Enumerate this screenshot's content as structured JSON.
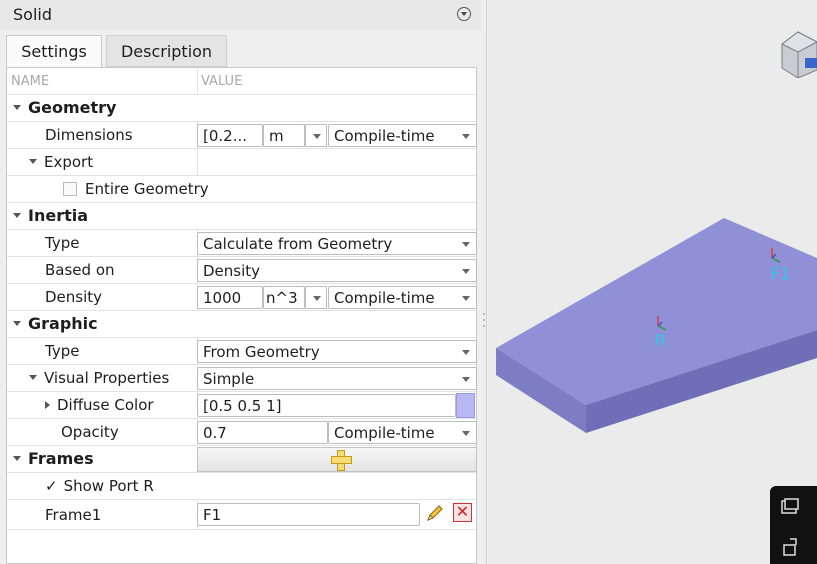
{
  "panel": {
    "title": "Solid",
    "tabs": [
      "Settings",
      "Description"
    ],
    "columns": {
      "name": "NAME",
      "value": "VALUE"
    }
  },
  "geometry": {
    "section": "Geometry",
    "dimensions_label": "Dimensions",
    "dimensions_value": "[0.2...",
    "dimensions_unit": "m",
    "dimensions_mode": "Compile-time",
    "export_label": "Export",
    "entire_geometry_label": "Entire Geometry",
    "entire_geometry_checked": false
  },
  "inertia": {
    "section": "Inertia",
    "type_label": "Type",
    "type_value": "Calculate from Geometry",
    "based_on_label": "Based on",
    "based_on_value": "Density",
    "density_label": "Density",
    "density_value": "1000",
    "density_unit": "n^3",
    "density_mode": "Compile-time"
  },
  "graphic": {
    "section": "Graphic",
    "type_label": "Type",
    "type_value": "From Geometry",
    "visual_label": "Visual Properties",
    "visual_value": "Simple",
    "diffuse_label": "Diffuse Color",
    "diffuse_value": "[0.5 0.5 1]",
    "diffuse_swatch": "#b8b9f3",
    "opacity_label": "Opacity",
    "opacity_value": "0.7",
    "opacity_mode": "Compile-time"
  },
  "frames": {
    "section": "Frames",
    "show_port_label": "Show Port R",
    "show_port_checked": true,
    "frame1_label": "Frame1",
    "frame1_value": "F1"
  },
  "viewport": {
    "frame_labels": [
      "R",
      "F1"
    ],
    "solid_color": "#8f90d6",
    "frame_label_color": "#32c6ec"
  }
}
